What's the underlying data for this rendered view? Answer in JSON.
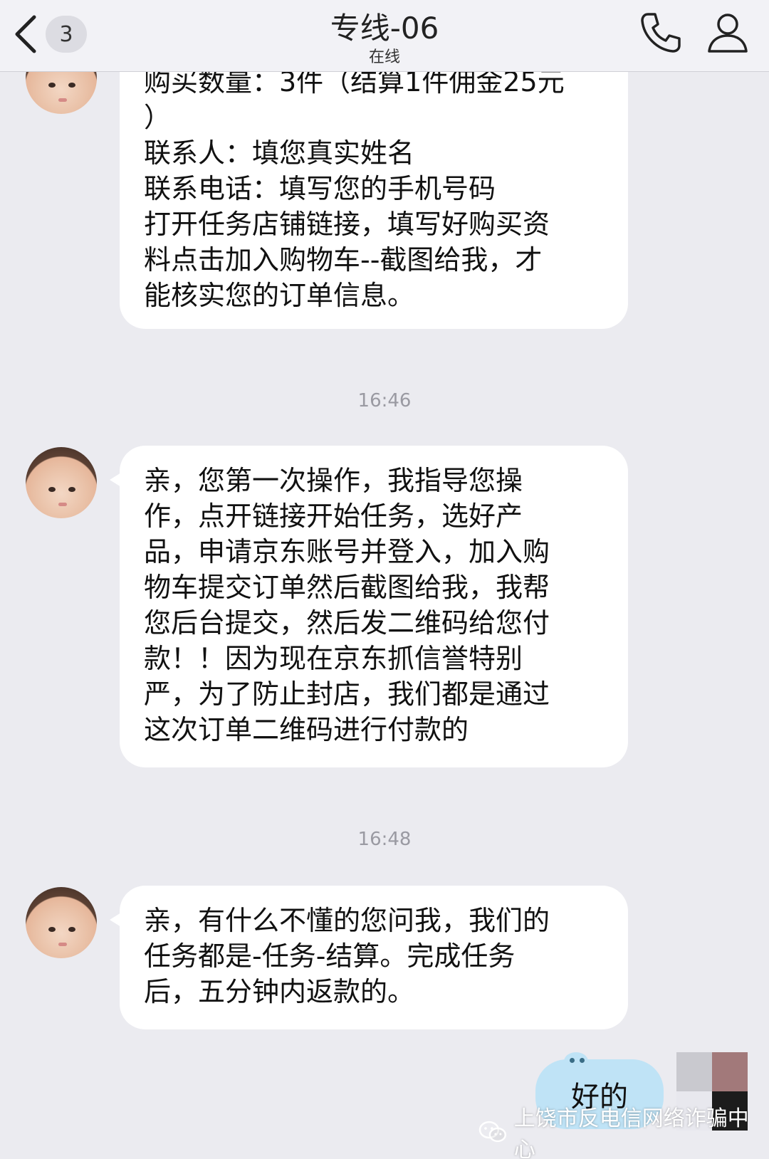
{
  "header": {
    "back_badge": "3",
    "title": "专线-06",
    "status": "在线"
  },
  "messages": [
    {
      "lines": [
        "购买数量：3件（结算1件佣金25元",
        "）",
        "联系人：填您真实姓名",
        "联系电话：填写您的手机号码",
        "打开任务店铺链接，填写好购买资",
        "料点击加入购物车--截图给我，才",
        "能核实您的订单信息。"
      ]
    },
    {
      "time": "16:46",
      "lines": [
        "亲，您第一次操作，我指导您操",
        "作，点开链接开始任务，选好产",
        "品，申请京东账号并登入，加入购",
        "物车提交订单然后截图给我，我帮",
        "您后台提交，然后发二维码给您付",
        "款！！因为现在京东抓信誉特别",
        "严，为了防止封店，我们都是通过",
        "这次订单二维码进行付款的"
      ]
    },
    {
      "time": "16:48",
      "lines": [
        "亲，有什么不懂的您问我，我们的",
        "任务都是-任务-结算。完成任务",
        "后，五分钟内返款的。"
      ]
    }
  ],
  "my_message": "好的",
  "watermark": "上饶市反电信网络诈骗中心",
  "colors": {
    "background": "#ebebf0",
    "header": "#f2f2f6",
    "incoming_bubble": "#ffffff",
    "outgoing_bubble": "#bfe3f6",
    "timestamp": "#9a9aa2"
  },
  "icons": [
    "back-chevron-icon",
    "phone-icon",
    "profile-icon",
    "wechat-icon"
  ]
}
